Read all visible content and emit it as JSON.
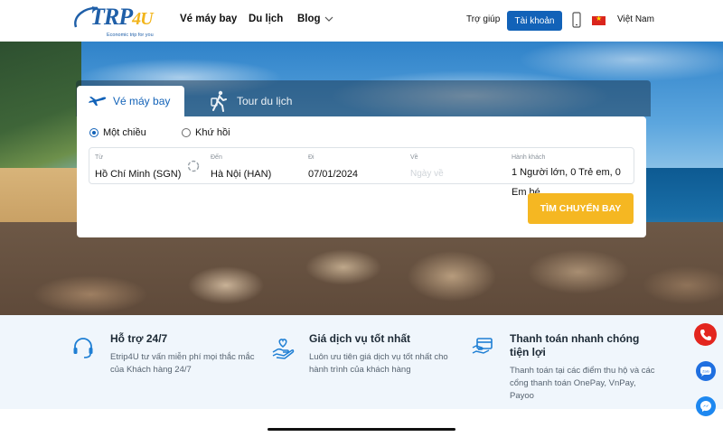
{
  "brand": {
    "logo_text": "eTRP4U",
    "tagline": "Economic trip for you"
  },
  "nav": {
    "flights": "Vé máy bay",
    "tour": "Du lịch",
    "blog": "Blog"
  },
  "header": {
    "help": "Trợ giúp",
    "account": "Tài khoản",
    "language": "Việt Nam"
  },
  "search": {
    "tabs": {
      "flights": "Vé máy bay",
      "tour": "Tour du lịch"
    },
    "trip_type": {
      "one_way": "Một chiều",
      "round_trip": "Khứ hồi",
      "selected": "one_way"
    },
    "from": {
      "caption": "Từ",
      "value": "Hồ Chí Minh (SGN)"
    },
    "to": {
      "caption": "Đến",
      "value": "Hà Nội (HAN)"
    },
    "depart": {
      "caption": "Đi",
      "value": "07/01/2024"
    },
    "return": {
      "caption": "Về",
      "placeholder": "Ngày về"
    },
    "passengers": {
      "caption": "Hành khách",
      "value": "1 Người lớn, 0 Trẻ em, 0 Em bé"
    },
    "submit": "TÌM CHUYẾN BAY"
  },
  "features": [
    {
      "title": "Hỗ trợ 24/7",
      "desc": "Etrip4U tư vấn miễn phí mọi thắc mắc của Khách hàng 24/7"
    },
    {
      "title": "Giá dịch vụ tốt nhất",
      "desc": "Luôn ưu tiên giá dịch vụ tốt nhất cho hành trình của khách hàng"
    },
    {
      "title": "Thanh toán nhanh chóng tiện lợi",
      "desc": "Thanh toán tại các điểm thu hộ và các cổng thanh toán OnePay, VnPay, Payoo"
    }
  ],
  "colors": {
    "primary": "#1262b8",
    "accent": "#f5b722",
    "call": "#e3261f"
  }
}
